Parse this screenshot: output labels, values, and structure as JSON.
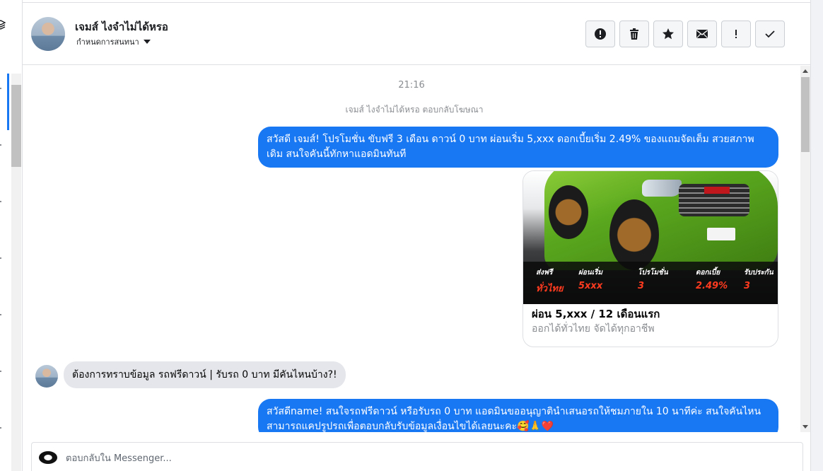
{
  "header": {
    "contact_name": "เจมส์ ไงจำไม่ได้หรอ",
    "assign_label": "กำหนดการสนทนา"
  },
  "actions": [
    {
      "icon": "alert-circle-icon"
    },
    {
      "icon": "trash-icon"
    },
    {
      "icon": "star-icon"
    },
    {
      "icon": "envelope-icon"
    },
    {
      "icon": "exclamation-icon"
    },
    {
      "icon": "check-icon"
    }
  ],
  "conversation": {
    "timestamp": "21:16",
    "system_note": "เจมส์ ไงจำไม่ได้หรอ ตอบกลับโฆษณา",
    "messages": {
      "out1": "สวัสดี เจมส์! โปรโมชั่น ขับฟรี 3 เดือน ดาวน์ 0 บาท ผ่อนเริ่ม 5,xxx  ดอกเบี้ยเริ่ม 2.49% ของแถมจัดเต็ม สวยสภาพเดิม สนใจคันนี้ทักหาแอดมินทันที",
      "in1": "ต้องการทราบข้อมูล รถฟรีดาวน์ | รับรถ 0 บาท มีคันไหนบ้าง?!",
      "out2": "สวัสดีname! สนใจรถฟรีดาวน์ หรือรับรถ 0 บาท แอดมินขออนุญาตินำเสนอรถให้ชมภายใน 10 นาทีค่ะ สนใจคันไหนสามารถแคปรูปรถเพื่อตอบกลับรับข้อมูลเงื่อนไขได้เลยนะคะ🥰🙏❤️"
    },
    "card": {
      "title": "ผ่อน 5,xxx / 12 เดือนแรก",
      "subtitle": "ออกได้ทั่วไทย จัดได้ทุกอาชีพ",
      "promo": [
        {
          "label": "ส่งฟรี",
          "value": "ทั่วไทย"
        },
        {
          "label": "ผ่อนเริ่ม",
          "value": "5xxx"
        },
        {
          "label": "โปรโมชั่น",
          "value": "3"
        },
        {
          "label": "ดอกเบี้ย",
          "value": "2.49%"
        },
        {
          "label": "รับประกัน",
          "value": "3"
        }
      ]
    }
  },
  "composer": {
    "placeholder": "ตอบกลับใน Messenger..."
  },
  "colors": {
    "accent": "#1877f2",
    "incoming_bubble": "#e4e6eb",
    "muted_text": "#8a8d91"
  }
}
